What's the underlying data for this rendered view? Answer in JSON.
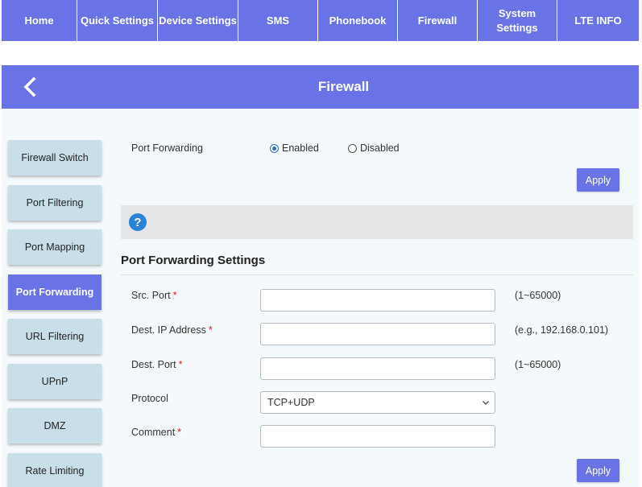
{
  "nav": {
    "items": [
      {
        "label": "Home"
      },
      {
        "label": "Quick Settings"
      },
      {
        "label": "Device Settings"
      },
      {
        "label": "SMS"
      },
      {
        "label": "Phonebook"
      },
      {
        "label": "Firewall"
      },
      {
        "label": "System\nSettings"
      },
      {
        "label": "LTE INFO"
      }
    ]
  },
  "header": {
    "title": "Firewall",
    "back_icon": "chevron-left-icon"
  },
  "sidebar": {
    "items": [
      {
        "label": "Firewall Switch"
      },
      {
        "label": "Port Filtering"
      },
      {
        "label": "Port Mapping"
      },
      {
        "label": "Port Forwarding",
        "active": true
      },
      {
        "label": "URL Filtering"
      },
      {
        "label": "UPnP"
      },
      {
        "label": "DMZ"
      },
      {
        "label": "Rate Limiting"
      }
    ]
  },
  "forwarding": {
    "label": "Port Forwarding",
    "enabled_label": "Enabled",
    "disabled_label": "Disabled",
    "selected": "Enabled",
    "apply_label": "Apply"
  },
  "help": {
    "icon": "question-icon",
    "glyph": "?"
  },
  "settings": {
    "title": "Port Forwarding Settings",
    "src_port": {
      "label": "Src. Port",
      "required": "*",
      "value": "",
      "hint": "(1~65000)"
    },
    "dest_ip": {
      "label": "Dest. IP Address",
      "required": "*",
      "value": "",
      "hint": "(e.g., 192.168.0.101)"
    },
    "dest_port": {
      "label": "Dest. Port",
      "required": "*",
      "value": "",
      "hint": "(1~65000)"
    },
    "protocol": {
      "label": "Protocol",
      "value": "TCP+UDP"
    },
    "comment": {
      "label": "Comment",
      "required": "*",
      "value": ""
    },
    "apply_label": "Apply"
  },
  "colors": {
    "accent": "#6a73e6",
    "sidebar_bg": "#c8dfea",
    "required": "#d9231a",
    "help_icon": "#2a84d6"
  }
}
